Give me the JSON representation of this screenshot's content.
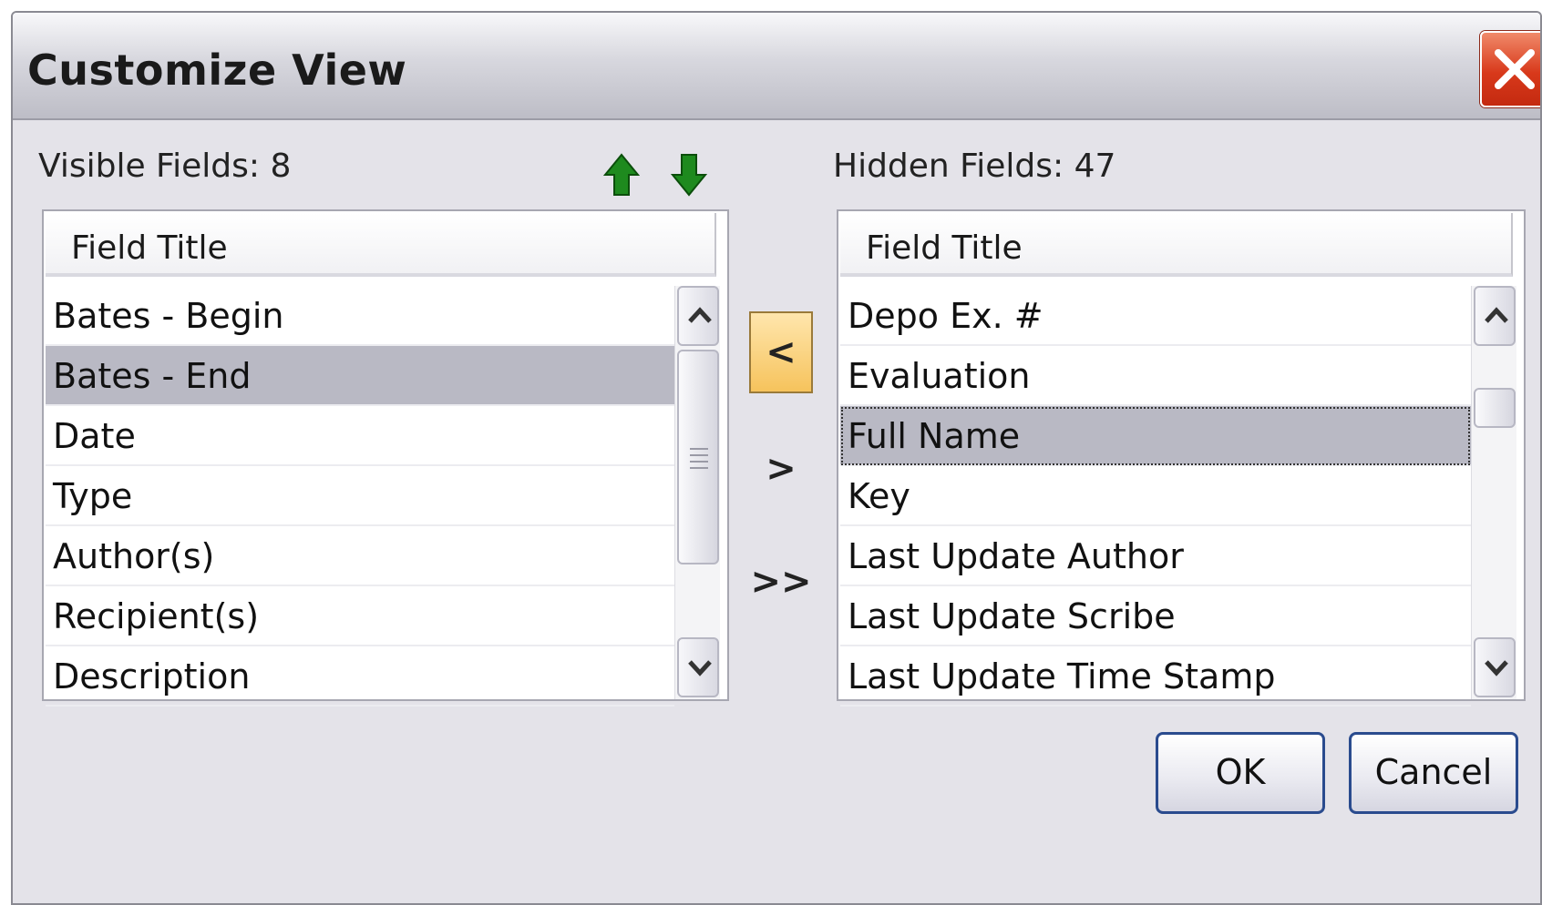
{
  "window": {
    "title": "Customize View",
    "close_icon": "close-icon"
  },
  "visible": {
    "label": "Visible Fields: 8",
    "header": "Field Title",
    "items": [
      "Bates - Begin",
      "Bates - End",
      "Date",
      "Type",
      "Author(s)",
      "Recipient(s)",
      "Description"
    ],
    "selected": "Bates - End"
  },
  "hidden": {
    "label": "Hidden Fields: 47",
    "header": "Field Title",
    "items": [
      "Depo Ex. #",
      "Evaluation",
      "Full Name",
      "Key",
      "Last Update Author",
      "Last Update Scribe",
      "Last Update Time Stamp"
    ],
    "selected": "Full Name"
  },
  "reorder": {
    "up_icon": "arrow-up-icon",
    "down_icon": "arrow-down-icon",
    "accent": "#1e8a1e"
  },
  "transfer": {
    "move_left": "<",
    "move_right": ">",
    "move_all_right": ">>"
  },
  "buttons": {
    "ok": "OK",
    "cancel": "Cancel"
  },
  "colors": {
    "dialog_bg": "#e4e3e9",
    "selection": "#b9b9c4",
    "active_button": "#f6c35c",
    "close_red": "#d8391b"
  }
}
